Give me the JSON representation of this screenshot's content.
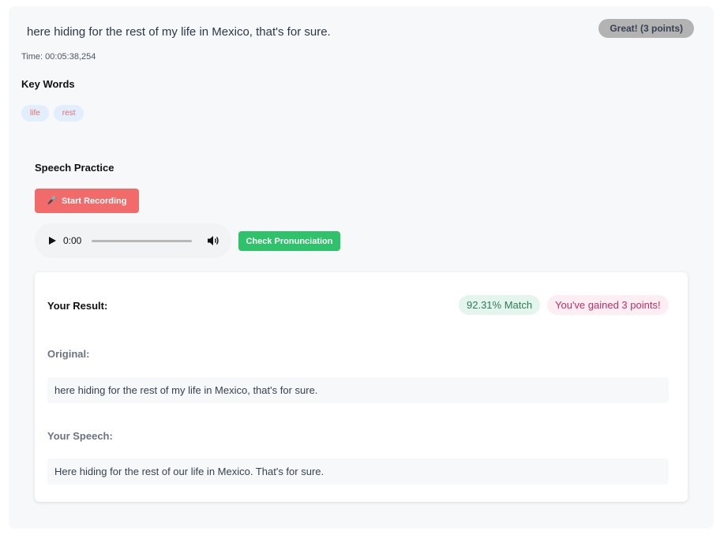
{
  "segment": {
    "sentence": "here hiding for the rest of my life in Mexico, that's for sure.",
    "rating_badge": "Great! (3 points)",
    "time_label": "Time: 00:05:38,254"
  },
  "key_words": {
    "title": "Key Words",
    "items": [
      "life",
      "rest"
    ]
  },
  "speech_practice": {
    "title": "Speech Practice",
    "record_label": "Start Recording",
    "record_icon": "microphone-icon",
    "player_time": "0:00",
    "player_progress": 0,
    "check_label": "Check Pronunciation"
  },
  "result": {
    "title": "Your Result:",
    "match_badge": "92.31% Match",
    "points_badge": "You've gained 3 points!",
    "original_label": "Original:",
    "original_text": "here hiding for the rest of my life in Mexico, that's for sure.",
    "speech_label": "Your Speech:",
    "speech_text": "Here hiding for the rest of our life in Mexico. That's for sure."
  },
  "colors": {
    "record_button": "#f26b6b",
    "check_button": "#2ec26a",
    "match_badge_bg": "#e4f5ee",
    "points_badge_bg": "#fdeef4"
  }
}
